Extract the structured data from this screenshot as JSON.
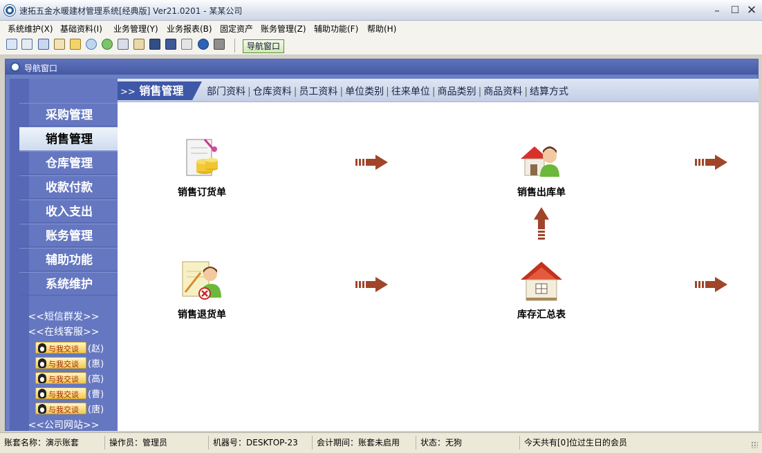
{
  "window": {
    "title": "速拓五金水暖建材管理系统[经典版] Ver21.0201  -  某某公司"
  },
  "menu": [
    "系统维护(X)",
    "基础资料(I)",
    "业务管理(Y)",
    "业务报表(B)",
    "固定资产",
    "账务管理(Z)",
    "辅助功能(F)",
    "帮助(H)"
  ],
  "toolbar": {
    "icons": [
      "grid-icon",
      "form-icon",
      "window-icon",
      "card-icon",
      "users-icon",
      "refresh-icon",
      "people-icon",
      "transfer-icon",
      "export-icon",
      "monitor-icon",
      "save-icon",
      "print-icon",
      "help-icon",
      "exit-icon"
    ],
    "nav_button_label": "导航窗口"
  },
  "inner_window": {
    "title": "导航窗口"
  },
  "sidebar": {
    "items": [
      {
        "label": "采购管理",
        "active": false
      },
      {
        "label": "销售管理",
        "active": true
      },
      {
        "label": "仓库管理",
        "active": false
      },
      {
        "label": "收款付款",
        "active": false
      },
      {
        "label": "收入支出",
        "active": false
      },
      {
        "label": "账务管理",
        "active": false
      },
      {
        "label": "辅助功能",
        "active": false
      },
      {
        "label": "系统维护",
        "active": false
      }
    ],
    "links": [
      "<<短信群发>>",
      "<<在线客服>>",
      "<<公司网站>>"
    ],
    "qq_label": "与我交谈",
    "qq_contacts": [
      "(赵)",
      "(惠)",
      "(高)",
      "(曹)",
      "(唐)"
    ]
  },
  "content": {
    "section_prefix": ">>",
    "section_title": "销售管理",
    "sub_links": [
      "部门资料",
      "仓库资料",
      "员工资料",
      "单位类别",
      "往来单位",
      "商品类别",
      "商品资料",
      "结算方式"
    ],
    "flow": [
      {
        "label": "销售订货单",
        "icon": "sales-order-icon"
      },
      {
        "label": "销售出库单",
        "icon": "sales-outbound-icon"
      },
      {
        "label": "销售退货单",
        "icon": "sales-return-icon"
      },
      {
        "label": "库存汇总表",
        "icon": "inventory-summary-icon"
      }
    ]
  },
  "status": {
    "account": "账套名称：演示账套",
    "operator": "操作员：管理员",
    "machine": "机器号：DESKTOP-23",
    "period": "会计期间：账套未启用",
    "state": "状态：无狗",
    "birthday": "今天共有[0]位过生日的会员"
  },
  "colors": {
    "sidebar": "#6577c0",
    "active_item": "#e6eef9",
    "arrow": "#a0452a",
    "section_tab": "#3e58a7"
  }
}
